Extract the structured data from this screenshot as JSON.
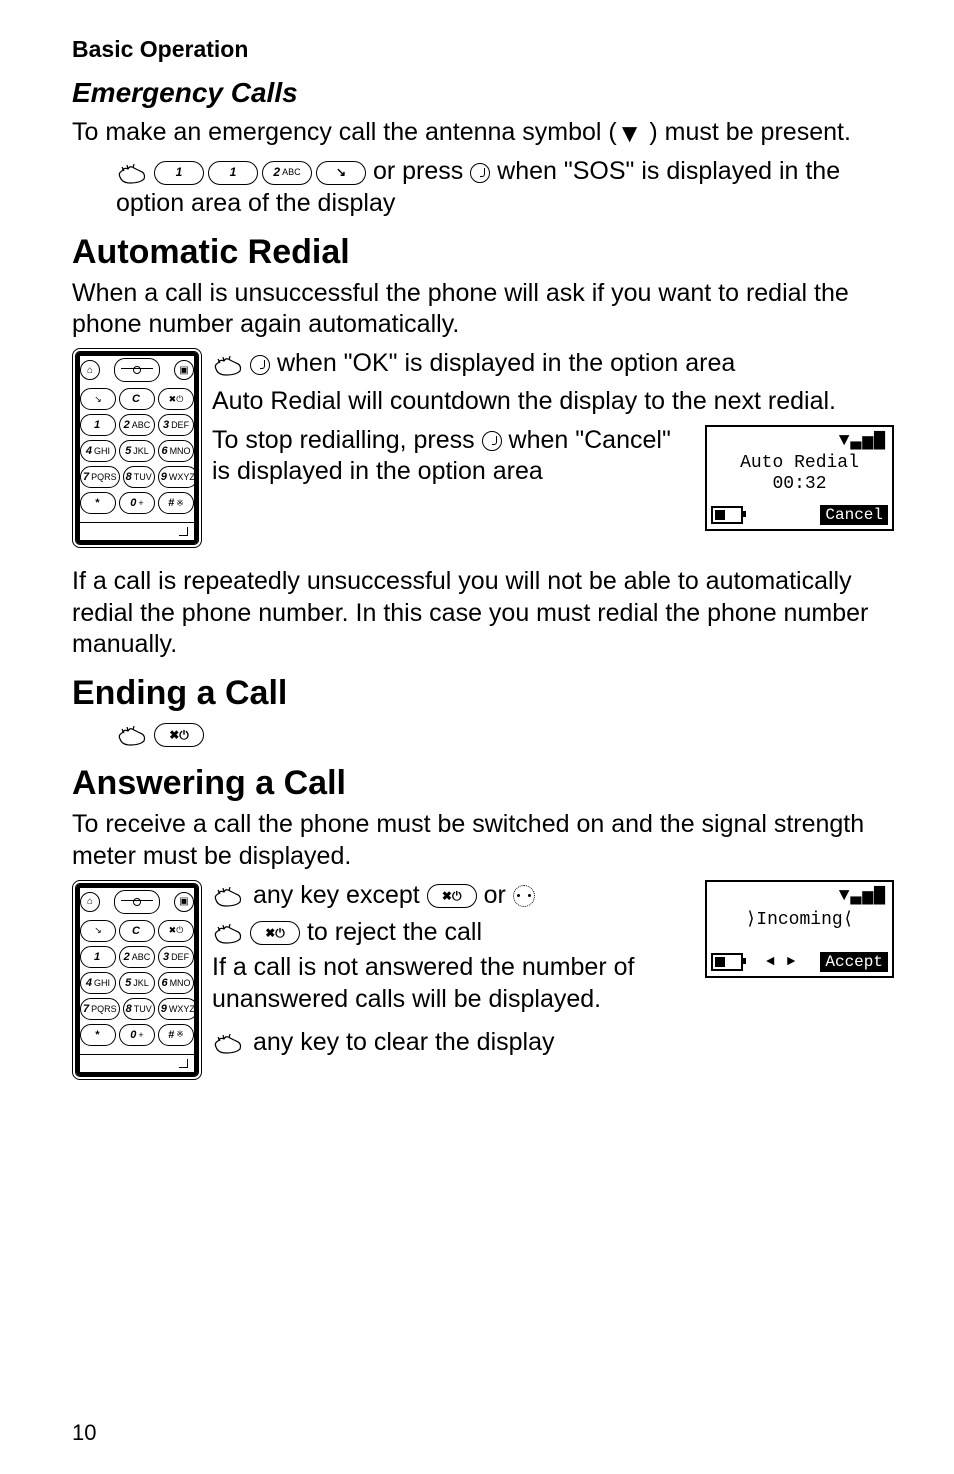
{
  "header": {
    "title": "Basic Operation"
  },
  "emergency": {
    "heading": "Emergency Calls",
    "p1_pre": "To make an emergency call the antenna symbol (",
    "p1_post": " ) must be present.",
    "instruction_tail": " when \"SOS\" is displayed in the option area of the display",
    "press_or": " or press "
  },
  "redial": {
    "heading": "Automatic Redial",
    "p1": "When a call is unsuccessful the phone will ask if you want to redial the phone number again automatically.",
    "step1": " when \"OK\" is displayed in the option area",
    "p2": "Auto Redial will countdown the display to the next redial.",
    "p3a": "To stop redialling, press ",
    "p3b": " when \"Cancel\" is displayed in the option area",
    "lcd": {
      "line1": "Auto Redial",
      "line2": "00:32",
      "soft": "Cancel",
      "signal": "▼▃▅▇"
    },
    "p4": "If a call is repeatedly unsuccessful you will not be able to automatically redial the phone number. In this case you must redial the phone number manually."
  },
  "ending": {
    "heading": "Ending a Call"
  },
  "answering": {
    "heading": "Answering a Call",
    "p1": "To receive a call the phone must be switched on and the signal strength meter must be displayed.",
    "s1_pre": " any key except ",
    "s1_or": " or ",
    "s2": " to reject the call",
    "p2": "If a call is not answered the number of unanswered calls will be displayed.",
    "s3": " any key to clear the display",
    "lcd": {
      "line1_pre": "Incoming",
      "soft": "Accept",
      "signal": "▼▃▅▇"
    }
  },
  "keypad": {
    "rows": [
      [
        "1",
        "2 ABC",
        "3 DEF"
      ],
      [
        "4 GHI",
        "5 JKL",
        "6 MNO"
      ],
      [
        "7 PQRS",
        "8 TUV",
        "9 WXYZ"
      ],
      [
        "*",
        "0 +",
        "# ※"
      ]
    ],
    "top_row": [
      "↘",
      "C",
      "✖⏻"
    ]
  },
  "keys": {
    "one": "1",
    "two": "2",
    "two_sub": "ABC",
    "send": "↘",
    "end": "✖⏻"
  },
  "page_number": "10"
}
